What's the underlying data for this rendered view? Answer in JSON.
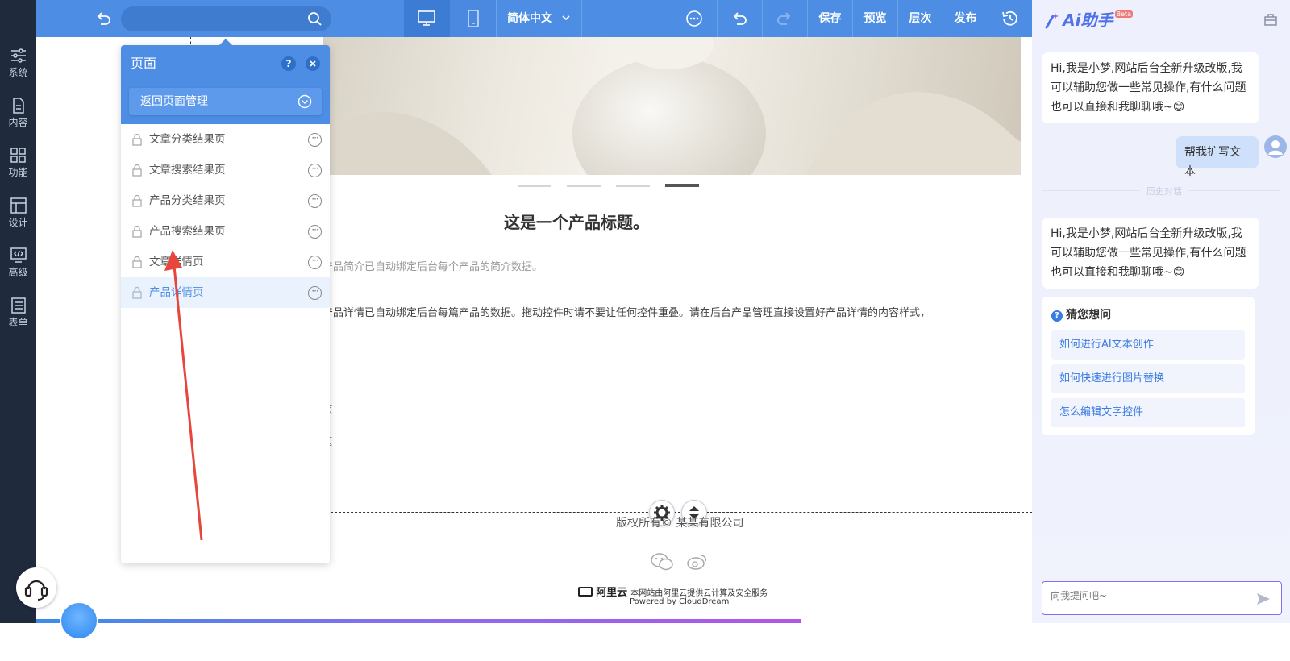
{
  "sidebar": {
    "items": [
      {
        "label": "系统",
        "icon": "sliders-icon"
      },
      {
        "label": "内容",
        "icon": "document-icon"
      },
      {
        "label": "功能",
        "icon": "grid-icon"
      },
      {
        "label": "设计",
        "icon": "layout-icon"
      },
      {
        "label": "高级",
        "icon": "code-monitor-icon"
      },
      {
        "label": "表单",
        "icon": "form-icon"
      }
    ]
  },
  "toolbar": {
    "language": "简体中文",
    "save": "保存",
    "preview": "预览",
    "layers": "层次",
    "publish": "发布"
  },
  "page_panel": {
    "title": "页面",
    "help": "?",
    "back_label": "返回页面管理",
    "items": [
      {
        "label": "文章分类结果页"
      },
      {
        "label": "文章搜索结果页"
      },
      {
        "label": "产品分类结果页"
      },
      {
        "label": "产品搜索结果页"
      },
      {
        "label": "文章详情页"
      },
      {
        "label": "产品详情页"
      }
    ]
  },
  "canvas": {
    "product_title": "这是一个产品标题。",
    "product_intro": "产品简介已自动绑定后台每个产品的简介数据。",
    "product_detail": "产品详情已自动绑定后台每篇产品的数据。拖动控件时请不要让任何控件重叠。请在后台产品管理直接设置好产品详情的内容样式，",
    "partial_a": "题",
    "partial_b": "题",
    "copyright": "版权所有© 某某有限公司",
    "aliyun_logo": "阿里云",
    "aliyun_text": "本网站由阿里云提供云计算及安全服务",
    "powered_by": "Powered by CloudDream"
  },
  "ai_panel": {
    "title": "Ai助手",
    "beta": "Beta",
    "greeting_1": "Hi,我是小梦,网站后台全新升级改版,我可以辅助您做一些常见操作,有什么问题也可以直接和我聊聊哦~😊",
    "user_message": "帮我扩写文本",
    "history_label": "历史对话",
    "greeting_2": "Hi,我是小梦,网站后台全新升级改版,我可以辅助您做一些常见操作,有什么问题也可以直接和我聊聊哦~😊",
    "guess_title": "猜您想问",
    "suggestions": [
      {
        "label": "如何进行AI文本创作"
      },
      {
        "label": "如何快速进行图片替换"
      },
      {
        "label": "怎么编辑文字控件"
      }
    ],
    "input_placeholder": "向我提问吧~"
  }
}
